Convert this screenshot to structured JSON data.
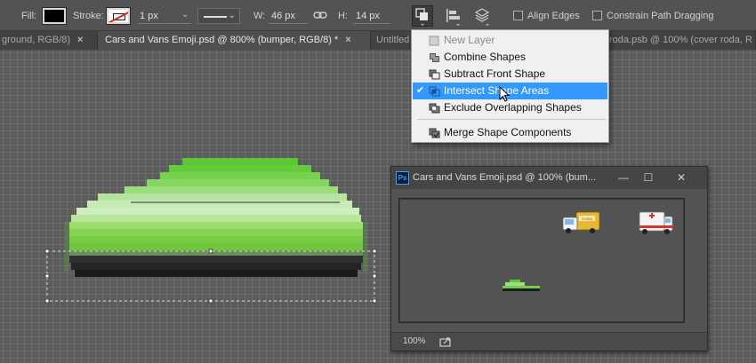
{
  "options_bar": {
    "fill_label": "Fill:",
    "stroke_label": "Stroke:",
    "stroke_width_value": "1 px",
    "width_label": "W:",
    "width_value": "46 px",
    "link_icon": "link-icon",
    "height_label": "H:",
    "height_value": "14 px",
    "path_operations_icon": "path-operations-icon",
    "path_alignment_icon": "path-alignment-icon",
    "path_arrangement_icon": "path-arrangement-icon",
    "align_edges_label": "Align Edges",
    "constrain_path_label": "Constrain Path Dragging",
    "fill_color": "#000000"
  },
  "tabs": [
    {
      "label": "ground, RGB/8)",
      "close": "×"
    },
    {
      "label": "Cars and Vans Emoji.psd @ 800% (bumper, RGB/8) *",
      "close": "×"
    },
    {
      "label": "Untitled"
    },
    {
      "label": "roda.psb @ 100% (cover roda, R"
    }
  ],
  "path_operations_menu": {
    "items": [
      {
        "label": "New Layer",
        "icon": "new-layer-icon",
        "disabled": true
      },
      {
        "label": "Combine Shapes",
        "icon": "combine-shapes-icon"
      },
      {
        "label": "Subtract Front Shape",
        "icon": "subtract-front-shape-icon"
      },
      {
        "label": "Intersect Shape Areas",
        "icon": "intersect-shape-areas-icon",
        "checked": true,
        "highlighted": true,
        "check": "✔"
      },
      {
        "label": "Exclude Overlapping Shapes",
        "icon": "exclude-overlapping-shapes-icon"
      },
      {
        "label": "Merge Shape Components",
        "icon": "merge-shape-components-icon"
      }
    ]
  },
  "document_window": {
    "logo": "Ps",
    "title": "Cars and Vans Emoji.psd @ 100% (bum...",
    "minimize": "—",
    "maximize": "☐",
    "close": "✕",
    "zoom_value": "100%",
    "share_icon": "share-icon",
    "van_sign_text": "Comp"
  },
  "colors": {
    "accent_highlight": "#3399ff",
    "car_green": "#6fcf3f",
    "car_light": "#c9eaa0",
    "bumper_dark": "#1c1c1c"
  }
}
